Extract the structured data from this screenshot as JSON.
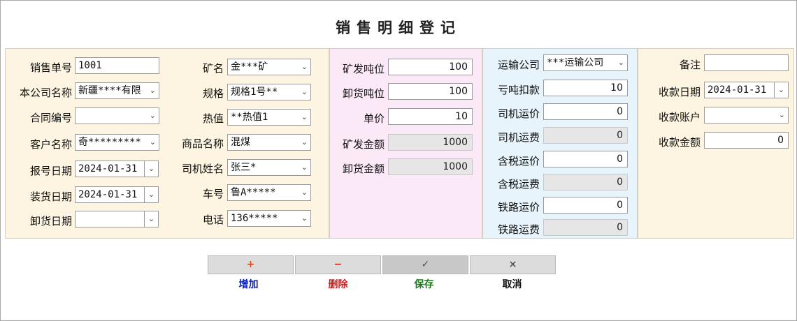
{
  "title": "销售明细登记",
  "colors": {
    "panel_cream": "#fdf5e1",
    "panel_pink": "#fbe9f8",
    "panel_blue": "#e7f4fc"
  },
  "left": {
    "sale_no": {
      "label": "销售单号",
      "value": "1001"
    },
    "company": {
      "label": "本公司名称",
      "value": "新疆****有限"
    },
    "contract_no": {
      "label": "合同编号",
      "value": ""
    },
    "customer": {
      "label": "客户名称",
      "value": "奇*********"
    },
    "report_date": {
      "label": "报号日期",
      "value": "2024-01-31"
    },
    "load_date": {
      "label": "装货日期",
      "value": "2024-01-31"
    },
    "unload_date": {
      "label": "卸货日期",
      "value": ""
    },
    "mine": {
      "label": "矿名",
      "value": "金***矿"
    },
    "spec": {
      "label": "规格",
      "value": "规格1号**"
    },
    "heat": {
      "label": "热值",
      "value": "**热值1"
    },
    "product": {
      "label": "商品名称",
      "value": "混煤"
    },
    "driver": {
      "label": "司机姓名",
      "value": "张三*"
    },
    "plate": {
      "label": "车号",
      "value": "鲁A*****"
    },
    "phone": {
      "label": "电话",
      "value": "136*****"
    }
  },
  "mid": {
    "mine_tons": {
      "label": "矿发吨位",
      "value": "100"
    },
    "unload_tons": {
      "label": "卸货吨位",
      "value": "100"
    },
    "unit_price": {
      "label": "单价",
      "value": "10"
    },
    "mine_amount": {
      "label": "矿发金额",
      "value": "1000"
    },
    "unload_amount": {
      "label": "卸货金额",
      "value": "1000"
    }
  },
  "transport": {
    "company": {
      "label": "运输公司",
      "value": "***运输公司"
    },
    "shortage": {
      "label": "亏吨扣款",
      "value": "10"
    },
    "driver_rate": {
      "label": "司机运价",
      "value": "0"
    },
    "driver_fee": {
      "label": "司机运费",
      "value": "0"
    },
    "tax_rate": {
      "label": "含税运价",
      "value": "0"
    },
    "tax_fee": {
      "label": "含税运费",
      "value": "0"
    },
    "rail_rate": {
      "label": "铁路运价",
      "value": "0"
    },
    "rail_fee": {
      "label": "铁路运费",
      "value": "0"
    }
  },
  "right": {
    "remark": {
      "label": "备注",
      "value": ""
    },
    "receive_date": {
      "label": "收款日期",
      "value": "2024-01-31"
    },
    "account": {
      "label": "收款账户",
      "value": ""
    },
    "receive_amount": {
      "label": "收款金额",
      "value": "0"
    }
  },
  "buttons": {
    "add": {
      "icon": "+",
      "label": "增加",
      "color": "#0b1fae"
    },
    "delete": {
      "icon": "−",
      "label": "删除",
      "color": "#d21c1c"
    },
    "save": {
      "icon": "✓",
      "label": "保存",
      "color": "#1a7a1a"
    },
    "cancel": {
      "icon": "×",
      "label": "取消",
      "color": "#111111"
    }
  }
}
